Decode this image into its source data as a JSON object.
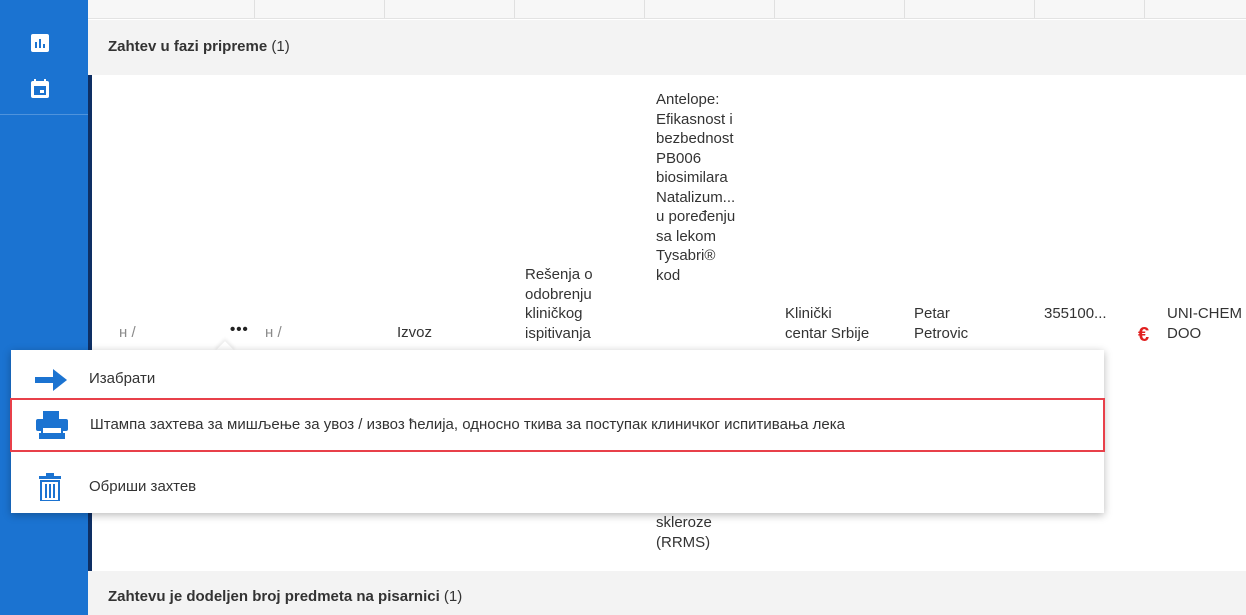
{
  "sidebar": {
    "icons": [
      "bar-chart-icon",
      "calendar-icon"
    ]
  },
  "groups": {
    "first": {
      "title": "Zahtev u fazi pripreme",
      "count": "(1)"
    },
    "second": {
      "title": "Zahtevu je dodeljen broj predmeta na pisarnici",
      "count": "(1)"
    }
  },
  "row": {
    "col1": "н /",
    "actions": "•••",
    "col3": "н /",
    "type": "Izvoz",
    "decision": "Rešenja o\nodobrenju\nkliničkog\nispitivanja",
    "study_top": "Antelope:\nEfikasnost i\nbezbednost\nPB006\nbiosimilara\nNatalizum...\nu poređenju\nsa lekom\nTysabri®\nkod",
    "study_bottom": "skleroze\n(RRMS)",
    "institution": "Klinički\ncentar Srbije",
    "person": "Petar\nPetrovic",
    "amount": "355100...",
    "currency": "€",
    "company": "UNI-CHEM\nDOO"
  },
  "menu": {
    "items": [
      {
        "label": "Изабрати",
        "icon": "arrow-right-icon"
      },
      {
        "label": "Штампа захтева за мишљење за увоз / извоз ћелија, односно ткива за поступак клиничког испитивања лека",
        "icon": "printer-icon"
      },
      {
        "label": "Обриши захтев",
        "icon": "trash-icon"
      }
    ]
  },
  "colors": {
    "sidebar": "#1b73d1",
    "accent": "#1b73d1",
    "highlight_border": "#e8404a",
    "euro": "#e02020"
  }
}
